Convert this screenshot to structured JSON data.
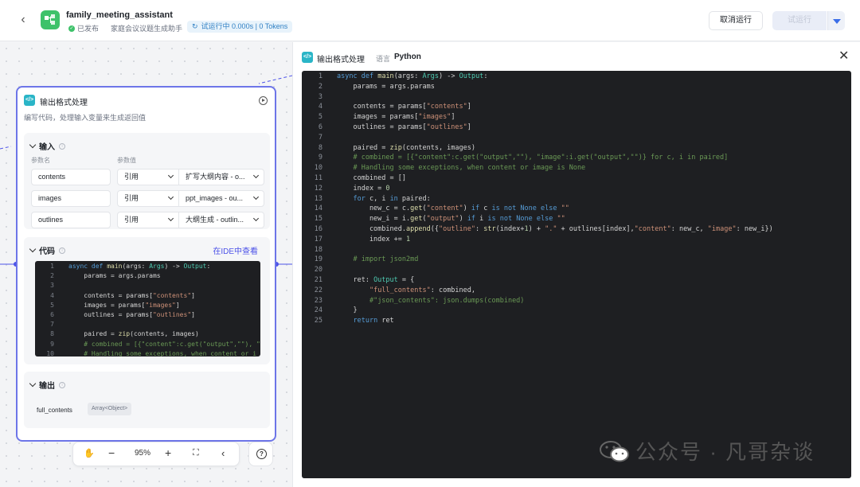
{
  "header": {
    "app_name": "family_meeting_assistant",
    "status": "已发布",
    "description": "家庭会议议题生成助手",
    "run_status": "试运行中 0.000s | 0 Tokens",
    "cancel_label": "取消运行",
    "test_label": "试运行"
  },
  "node": {
    "title": "输出格式处理",
    "description": "编写代码，处理输入变量来生成返回值",
    "input_section": "输入",
    "col_param_name": "参数名",
    "col_param_value": "参数值",
    "inputs": [
      {
        "name": "contents",
        "type": "引用",
        "value": "扩写大纲内容 - o..."
      },
      {
        "name": "images",
        "type": "引用",
        "value": "ppt_images - ou..."
      },
      {
        "name": "outlines",
        "type": "引用",
        "value": "大纲生成 - outlin..."
      }
    ],
    "code_section": "代码",
    "view_in_ide": "在IDE中查看",
    "mini_code": [
      "async def main(args: Args) -> Output:",
      "    params = args.params",
      "",
      "    contents = params[\"contents\"]",
      "    images = params[\"images\"]",
      "    outlines = params[\"outlines\"]",
      "",
      "    paired = zip(contents, images)",
      "    # combined = [{\"content\":c.get(\"output\",\"\"), \"",
      "    # Handling some exceptions, when content or i"
    ],
    "output_section": "输出",
    "output_name": "full_contents",
    "output_type": "Array<Object>"
  },
  "zoom": {
    "level": "95%"
  },
  "panel": {
    "title": "输出格式处理",
    "lang_label": "语言",
    "language": "Python"
  },
  "code_lines": [
    "async def main(args: Args) -> Output:",
    "    params = args.params",
    "",
    "    contents = params[\"contents\"]",
    "    images = params[\"images\"]",
    "    outlines = params[\"outlines\"]",
    "",
    "    paired = zip(contents, images)",
    "    # combined = [{\"content\":c.get(\"output\",\"\"), \"image\":i.get(\"output\",\"\")} for c, i in paired]",
    "    # Handling some exceptions, when content or image is None",
    "    combined = []",
    "    index = 0",
    "    for c, i in paired:",
    "        new_c = c.get(\"content\") if c is not None else \"\"",
    "        new_i = i.get(\"output\") if i is not None else \"\"",
    "        combined.append({\"outline\": str(index+1) + \".\" + outlines[index],\"content\": new_c, \"image\": new_i})",
    "        index += 1",
    "",
    "    # import json2md",
    "",
    "    ret: Output = {",
    "        \"full_contents\": combined,",
    "        #\"json_contents\": json.dumps(combined)",
    "    }",
    "    return ret"
  ],
  "watermark": "公众号 · 凡哥杂谈",
  "icons": [
    "back-arrow-icon",
    "app-logo-icon",
    "published-check-icon",
    "loading-icon",
    "dropdown-caret-icon",
    "code-node-icon",
    "run-node-icon",
    "chevron-down-icon",
    "info-icon",
    "hand-icon",
    "zoom-out-icon",
    "zoom-in-icon",
    "fit-view-icon",
    "minimap-icon",
    "help-icon",
    "close-icon",
    "wechat-icon"
  ]
}
